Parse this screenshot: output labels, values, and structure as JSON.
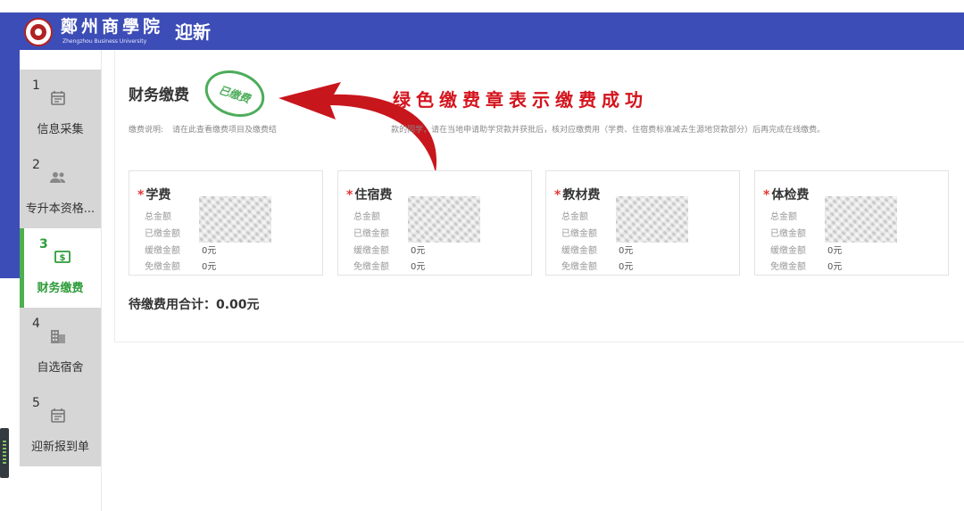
{
  "header": {
    "school_name_cn": "鄭州商學院",
    "school_name_en": "Zhengzhou Business University",
    "page_title": "迎新"
  },
  "sidebar": {
    "steps": [
      {
        "num": "1",
        "label": "信息采集",
        "icon": "calendar-icon",
        "active": false
      },
      {
        "num": "2",
        "label": "专升本资格...",
        "icon": "people-icon",
        "active": false
      },
      {
        "num": "3",
        "label": "财务缴费",
        "icon": "dollar-icon",
        "active": true
      },
      {
        "num": "4",
        "label": "自选宿舍",
        "icon": "building-icon",
        "active": false
      },
      {
        "num": "5",
        "label": "迎新报到单",
        "icon": "calendar-icon",
        "active": false
      }
    ]
  },
  "main": {
    "title": "财务缴费",
    "stamp_text": "已缴费",
    "callout": "绿色缴费章表示缴费成功",
    "note_label": "缴费说明:",
    "note_part1": "请在此查看缴费项目及缴费结",
    "note_part2": "款的同学，请在当地申请助学贷款并获批后，核对应缴费用（学费、住宿费标准减去生源地贷款部分）后再完成在线缴费。",
    "fees": [
      {
        "title": "学费",
        "labels": [
          "总金额",
          "已缴金额",
          "缓缴金额",
          "免缴金额"
        ],
        "deferred": "0元",
        "exempt": "0元"
      },
      {
        "title": "住宿费",
        "labels": [
          "总金额",
          "已缴金额",
          "缓缴金额",
          "免缴金额"
        ],
        "deferred": "0元",
        "exempt": "0元"
      },
      {
        "title": "教材费",
        "labels": [
          "总金额",
          "已缴金额",
          "缓缴金额",
          "免缴金额"
        ],
        "deferred": "0元",
        "exempt": "0元"
      },
      {
        "title": "体检费",
        "labels": [
          "总金额",
          "已缴金额",
          "缓缴金额",
          "免缴金额"
        ],
        "deferred": "0元",
        "exempt": "0元"
      }
    ],
    "total_label": "待缴费用合计：",
    "total_value": "0.00元"
  },
  "colors": {
    "header": "#3d4db7",
    "active_green": "#4caf50",
    "callout_red": "#d4141d"
  }
}
